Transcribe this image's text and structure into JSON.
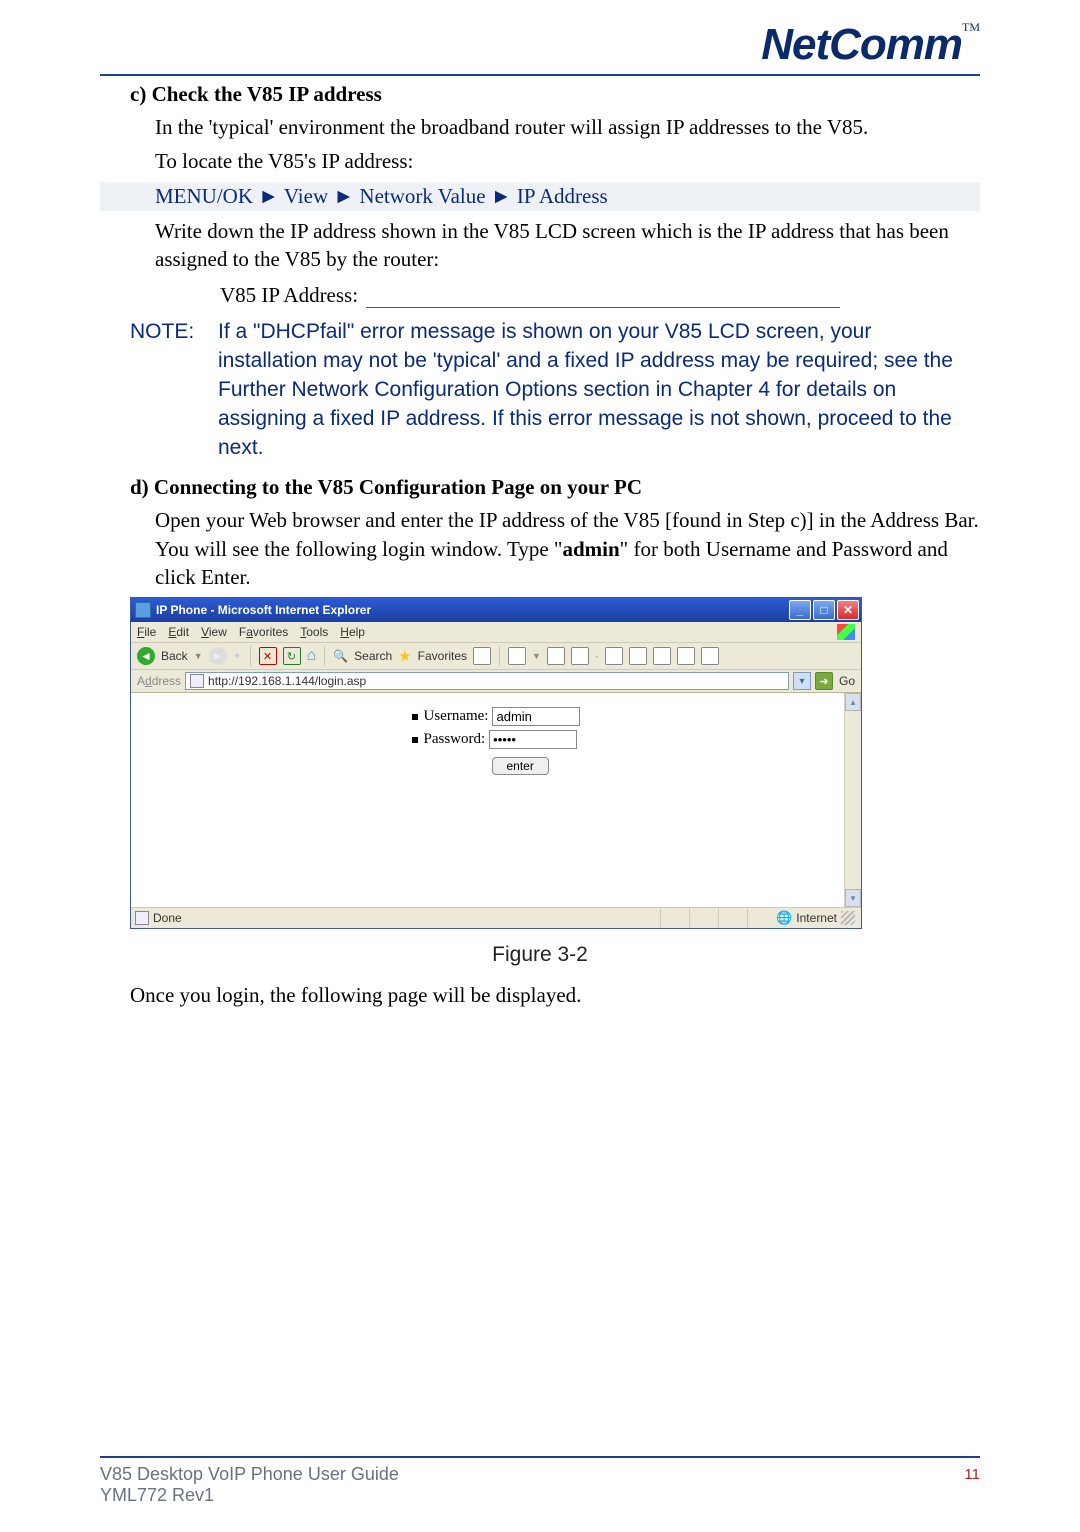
{
  "logo": {
    "text": "NetComm",
    "tm": "TM"
  },
  "section_c": {
    "heading": "c)  Check the V85 IP address",
    "p1": "In the 'typical' environment the broadband router will assign IP addresses to the V85.",
    "p2": "To locate the V85's IP address:",
    "nav": "MENU/OK ► View ► Network Value ► IP Address",
    "p3": "Write down the IP address shown in the V85 LCD screen which is the IP address that has been assigned to the V85 by the router:",
    "ip_label": "V85 IP Address:"
  },
  "note": {
    "label": "NOTE:",
    "text": "If a \"DHCPfail\" error message is shown on your V85 LCD screen, your installation may not be 'typical' and a fixed IP address may be required; see the Further Network Configuration Options section in Chapter 4 for details on assigning a fixed IP address.  If this error message is not shown, proceed to the next."
  },
  "section_d": {
    "heading": "d)  Connecting to the V85 Configuration Page on your PC",
    "p1_a": "Open your Web browser and enter the IP address of the V85 [found in Step c)] in the Address Bar.  You will see the following login window. Type \"",
    "p1_b": "admin",
    "p1_c": "\" for both Username and Password and click Enter."
  },
  "ie": {
    "title": "IP Phone - Microsoft Internet Explorer",
    "menu": {
      "file": "File",
      "edit": "Edit",
      "view": "View",
      "favorites": "Favorites",
      "tools": "Tools",
      "help": "Help"
    },
    "toolbar": {
      "back": "Back",
      "search": "Search",
      "favorites": "Favorites"
    },
    "address_label": "Address",
    "url": "http://192.168.1.144/login.asp",
    "go": "Go",
    "login": {
      "username_label": "Username:",
      "username_value": "admin",
      "password_label": "Password:",
      "password_value": "•••••",
      "enter": "enter"
    },
    "status_done": "Done",
    "status_zone": "Internet"
  },
  "figure_caption": "Figure 3-2",
  "after_figure": "Once you login, the following page will be displayed.",
  "footer": {
    "line1": "V85 Desktop VoIP Phone User Guide",
    "line2": "YML772 Rev1",
    "page": "11"
  }
}
